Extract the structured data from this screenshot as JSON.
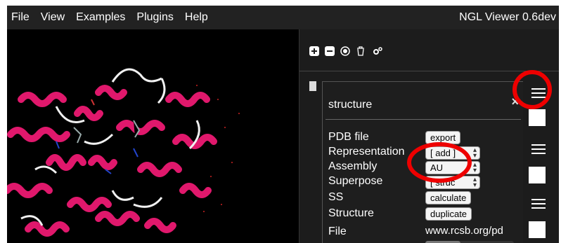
{
  "menubar": {
    "items": [
      {
        "label": "File"
      },
      {
        "label": "View"
      },
      {
        "label": "Examples"
      },
      {
        "label": "Plugins"
      },
      {
        "label": "Help"
      }
    ],
    "app_title": "NGL Viewer 0.6dev"
  },
  "toolbar": {
    "icons": [
      "add-icon",
      "remove-icon",
      "center-icon",
      "trash-icon",
      "settings-icon"
    ]
  },
  "panel": {
    "title": "structure",
    "close": "×",
    "properties": {
      "pdb_file": {
        "label": "PDB file",
        "value": "export"
      },
      "representation": {
        "label": "Representation",
        "value": "[ add ]"
      },
      "assembly": {
        "label": "Assembly",
        "value": "AU"
      },
      "superpose": {
        "label": "Superpose",
        "value": "[ struc"
      },
      "ss": {
        "label": "SS",
        "value": "calculate"
      },
      "structure": {
        "label": "Structure",
        "value": "duplicate"
      },
      "file": {
        "label": "File",
        "value": "www.rcsb.org/pd"
      }
    }
  },
  "colors": {
    "background": "#000000",
    "menubar": "#222222",
    "sidebar": "#1c1c1c",
    "ribbon": "#e0186c",
    "annotation": "#ee0000"
  }
}
